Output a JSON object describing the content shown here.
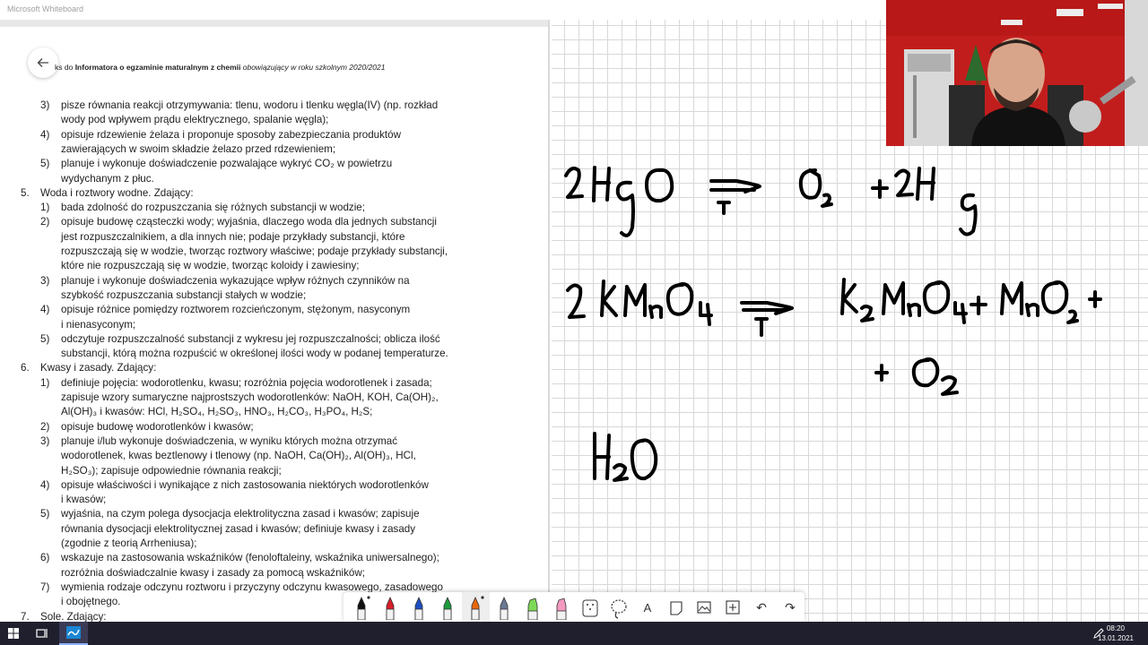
{
  "window": {
    "title": "Microsoft Whiteboard"
  },
  "document": {
    "header_prefix": "ks do ",
    "header_bold": "Informatora o egzaminie maturalnym z chemii",
    "header_italic": " obowiązujący w roku szkolnym 2020/2021",
    "lines": [
      {
        "num": "3)",
        "text": "pisze równania reakcji otrzymywania: tlenu, wodoru i tlenku węgla(IV) (np. rozkład"
      },
      {
        "num": "",
        "text": "wody pod wpływem prądu elektrycznego, spalanie węgla);"
      },
      {
        "num": "4)",
        "text": "opisuje rdzewienie żelaza i proponuje sposoby zabezpieczania produktów"
      },
      {
        "num": "",
        "text": "zawierających w swoim składzie żelazo przed rdzewieniem;"
      },
      {
        "num": "5)",
        "text": "planuje i wykonuje doświadczenie pozwalające wykryć CO₂ w powietrzu"
      },
      {
        "num": "",
        "text": "wydychanym z płuc."
      },
      {
        "num": "5.",
        "text": "Woda i roztwory wodne. Zdający:",
        "level": 0
      },
      {
        "num": "1)",
        "text": "bada zdolność do rozpuszczania się różnych substancji w wodzie;"
      },
      {
        "num": "2)",
        "text": "opisuje budowę cząsteczki wody; wyjaśnia, dlaczego woda dla jednych substancji"
      },
      {
        "num": "",
        "text": "jest rozpuszczalnikiem, a dla innych nie; podaje przykłady substancji, które"
      },
      {
        "num": "",
        "text": "rozpuszczają się w wodzie, tworząc roztwory właściwe; podaje przykłady substancji,"
      },
      {
        "num": "",
        "text": "które nie rozpuszczają się w wodzie, tworząc koloidy i zawiesiny;"
      },
      {
        "num": "3)",
        "text": "planuje i wykonuje doświadczenia wykazujące wpływ różnych czynników na"
      },
      {
        "num": "",
        "text": "szybkość rozpuszczania substancji stałych w wodzie;"
      },
      {
        "num": "4)",
        "text": "opisuje różnice pomiędzy roztworem rozcieńczonym, stężonym, nasyconym"
      },
      {
        "num": "",
        "text": "i nienasyconym;"
      },
      {
        "num": "5)",
        "text": "odczytuje rozpuszczalność substancji z wykresu jej rozpuszczalności; oblicza ilość"
      },
      {
        "num": "",
        "text": "substancji, którą można rozpuścić w określonej ilości wody w podanej temperaturze."
      },
      {
        "num": "6.",
        "text": "Kwasy i zasady. Zdający:",
        "level": 0
      },
      {
        "num": "1)",
        "text": "definiuje pojęcia: wodorotlenku, kwasu; rozróżnia pojęcia wodorotlenek i zasada;"
      },
      {
        "num": "",
        "text": "zapisuje wzory sumaryczne najprostszych wodorotlenków: NaOH, KOH, Ca(OH)₂,"
      },
      {
        "num": "",
        "text": "Al(OH)₃ i kwasów: HCl, H₂SO₄, H₂SO₃, HNO₃, H₂CO₃, H₃PO₄, H₂S;"
      },
      {
        "num": "2)",
        "text": "opisuje budowę wodorotlenków i kwasów;"
      },
      {
        "num": "3)",
        "text": "planuje i/lub wykonuje doświadczenia, w wyniku których można otrzymać"
      },
      {
        "num": "",
        "text": "wodorotlenek, kwas beztlenowy i tlenowy (np. NaOH, Ca(OH)₂, Al(OH)₃, HCl,"
      },
      {
        "num": "",
        "text": "H₂SO₃); zapisuje odpowiednie równania reakcji;"
      },
      {
        "num": "4)",
        "text": "opisuje właściwości i wynikające z nich zastosowania niektórych wodorotlenków"
      },
      {
        "num": "",
        "text": "i kwasów;"
      },
      {
        "num": "5)",
        "text": "wyjaśnia, na czym polega dysocjacja elektrolityczna zasad i kwasów; zapisuje"
      },
      {
        "num": "",
        "text": "równania dysocjacji elektrolitycznej zasad i kwasów; definiuje kwasy i zasady"
      },
      {
        "num": "",
        "text": "(zgodnie z teorią Arrheniusa);"
      },
      {
        "num": "6)",
        "text": "wskazuje na zastosowania wskaźników (fenoloftaleiny, wskaźnika uniwersalnego);"
      },
      {
        "num": "",
        "text": "rozróżnia doświadczalnie kwasy i zasady za pomocą wskaźników;"
      },
      {
        "num": "7)",
        "text": "wymienia rodzaje odczynu roztworu i przyczyny odczynu kwasowego, zasadowego"
      },
      {
        "num": "",
        "text": "i obojętnego."
      },
      {
        "num": "7.",
        "text": "Sole. Zdający:",
        "level": 0
      }
    ]
  },
  "whiteboard": {
    "equations": [
      {
        "id": "eq1",
        "text": "2HgO →T O₂ + 2Hg"
      },
      {
        "id": "eq2",
        "text": "2KMnO₄ →T K₂MnO₄ + MnO₂ + + O₂"
      },
      {
        "id": "eq3",
        "text": "H₂O"
      }
    ]
  },
  "toolbar": {
    "tools": [
      {
        "name": "pen-black-icon",
        "color": "#111111",
        "kind": "pen",
        "dot": true
      },
      {
        "name": "pen-red-icon",
        "color": "#d71f2b",
        "kind": "pen"
      },
      {
        "name": "pen-blue-icon",
        "color": "#1f4fbf",
        "kind": "pen"
      },
      {
        "name": "pen-green-icon",
        "color": "#1c9a3a",
        "kind": "pen"
      },
      {
        "name": "pen-orange-icon",
        "color": "#e8670e",
        "kind": "pen",
        "selected": true,
        "dot": true
      },
      {
        "name": "pen-gray-icon",
        "color": "#6b7894",
        "kind": "pen"
      },
      {
        "name": "highlighter-green-icon",
        "color": "#7ed957",
        "kind": "highlighter"
      },
      {
        "name": "highlighter-pink-icon",
        "color": "#f49ac1",
        "kind": "highlighter"
      },
      {
        "name": "eraser-icon",
        "color": "#333333",
        "kind": "eraser"
      },
      {
        "name": "lasso-icon",
        "color": "#333333",
        "kind": "lasso"
      },
      {
        "name": "text-icon",
        "color": "#333333",
        "kind": "text",
        "glyph": "A"
      },
      {
        "name": "note-icon",
        "color": "#333333",
        "kind": "note"
      },
      {
        "name": "image-icon",
        "color": "#333333",
        "kind": "image"
      },
      {
        "name": "insert-icon",
        "color": "#333333",
        "kind": "insert"
      },
      {
        "name": "undo-icon",
        "color": "#333333",
        "kind": "undo",
        "glyph": "↶"
      },
      {
        "name": "redo-icon",
        "color": "#333333",
        "kind": "redo",
        "glyph": "↷"
      }
    ]
  },
  "taskbar": {
    "time": "08:20",
    "date": "13.01.2021",
    "accent": "#1f1f2e"
  }
}
